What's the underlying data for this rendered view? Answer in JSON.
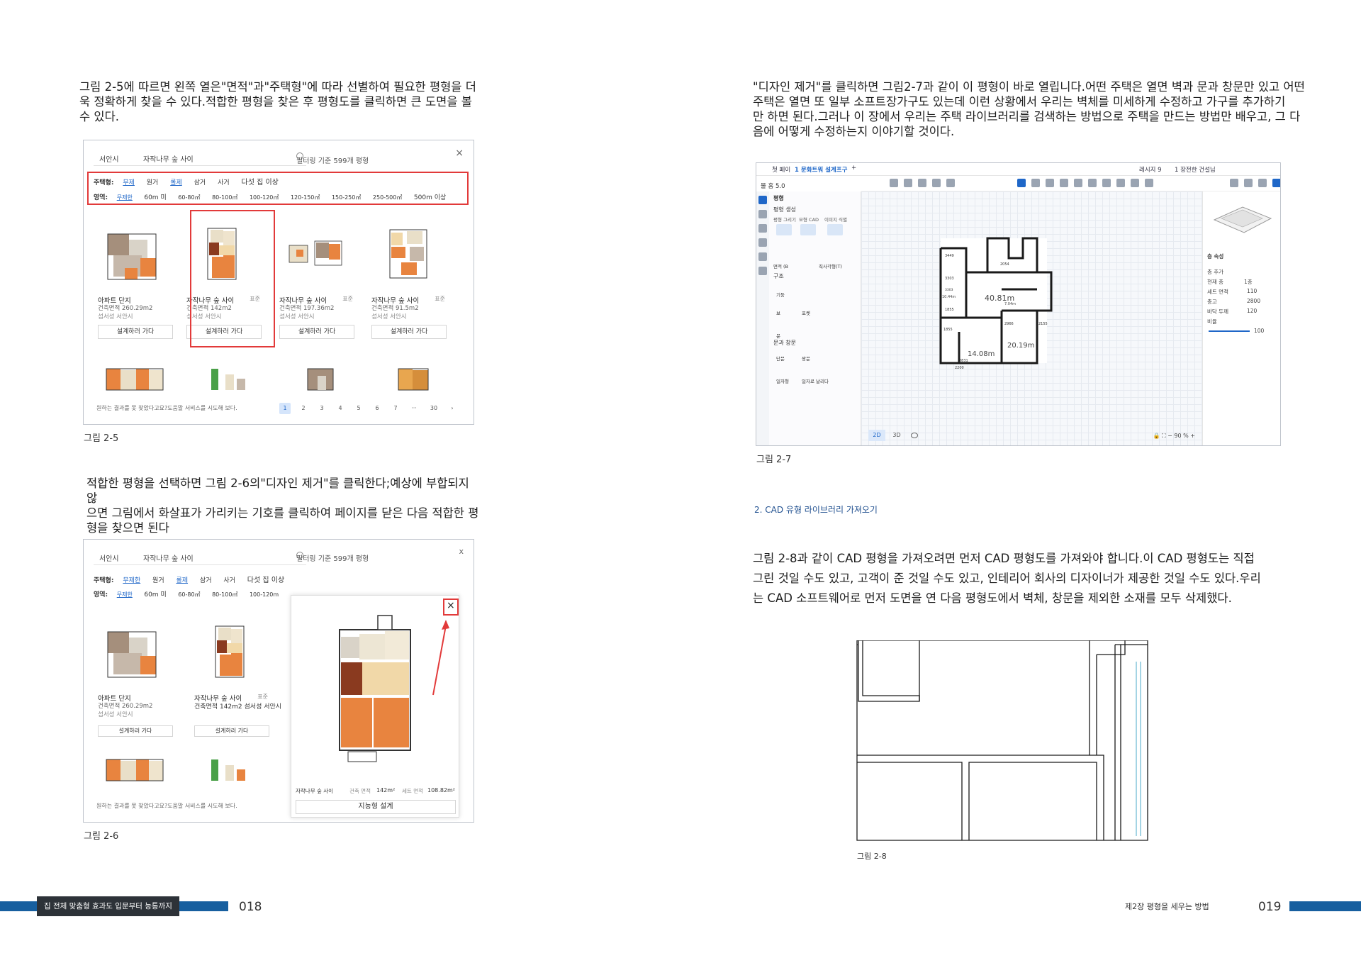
{
  "left": {
    "intro_lines": [
      "그림 2-5에 따르면 왼쪽 열은\"면적\"과\"주택형\"에 따라 선별하여 필요한 평형을 더",
      "욱 정확하게 찾을 수 있다.적합한 평형을 찾은 후 평형도를 클릭하면 큰 도면을 볼",
      "수 있다."
    ],
    "fig5": {
      "city": "서안시",
      "keyword": "자작나무 숲 사이",
      "count": "필터링 기준 599개 평형",
      "close": "×",
      "type_row": {
        "label": "주택형:",
        "items": [
          "무제",
          "원거",
          "롤제",
          "삼거",
          "사거",
          "다섯 집 이상"
        ]
      },
      "area_row": {
        "label": "영역:",
        "items": [
          "무제한",
          "60m 미",
          "60-80㎡",
          "80-100㎡",
          "100-120㎡",
          "120-150㎡",
          "150-250㎡",
          "250-500㎡",
          "500m 이상"
        ]
      },
      "cards": [
        {
          "t1": "아파트 단지",
          "t2": "건축면적 260.29m2",
          "t3": "섬서성 서안시",
          "tag": "",
          "btn": "설계하러 가다"
        },
        {
          "t1": "자작나무 숲 사이",
          "t2": "건축면적 142m2",
          "t3": "섬서성 서안시",
          "tag": "표준",
          "btn": "설계하러 가다"
        },
        {
          "t1": "자작나무 숲 사이",
          "t2": "건축면적 197.36m2",
          "t3": "섬서성 서안시",
          "tag": "표준",
          "btn": "설계하러 가다"
        },
        {
          "t1": "자작나무 숲 사이",
          "t2": "건축면적 91.5m2",
          "t3": "섬서성 서안시",
          "tag": "표준",
          "btn": "설계하러 가다"
        }
      ],
      "footer_note": "원하는 결과를 못 찾았다고요?도움말 서비스를 시도해 보다.",
      "pages": [
        "1",
        "2",
        "3",
        "4",
        "5",
        "6",
        "7",
        "···",
        "30",
        "›"
      ]
    },
    "fig5_caption": "그림 2-5",
    "mid_lines": [
      "적합한 평형을 선택하면 그림 2-6의\"디자인 제거\"를 클릭한다;예상에 부합되지 않",
      "으면 그림에서 화살표가 가리키는 기호를 클릭하여 페이지를 닫은 다음 적합한 평",
      "형을 찾으면 된다"
    ],
    "fig6": {
      "city": "서안시",
      "keyword": "자작나무 숲 사이",
      "count": "필터링 기준 599개 평형",
      "close": "x",
      "type_row": {
        "label": "주택형:",
        "items": [
          "무제한",
          "원거",
          "롤제",
          "삼거",
          "사거",
          "다섯 집 이상"
        ]
      },
      "area_row": {
        "label": "영역:",
        "items": [
          "무제한",
          "60m 미",
          "60-80㎡",
          "80-100㎡",
          "100-120m"
        ]
      },
      "cards": [
        {
          "t1": "아파트 단지",
          "t2": "건축면적 260.29m2",
          "t3": "섬서성 서안시",
          "tag": "",
          "btn": "설계하러 가다"
        },
        {
          "t1": "자작나무 숲 사이",
          "t2": "건축면적 142m2 섬서성 서안시",
          "t3": "",
          "tag": "표준",
          "btn": "설계하러 가다"
        }
      ],
      "popup": {
        "close": "×",
        "name": "자작나무 숲 사이",
        "built_label": "건축 면적",
        "built_value": "142m²",
        "set_label": "세트 면적",
        "set_value": "108.82m²",
        "btn": "지능형 설계"
      },
      "footer_note": "원하는 결과를 못 찾았다고요?도움말 서비스를 시도해 보다."
    },
    "fig6_caption": "그림 2-6",
    "footer": {
      "tab": "집 전체 맞춤형 효과도 입문부터 능통까지",
      "page": "018"
    }
  },
  "right": {
    "intro_lines": [
      "\"디자인 제거\"를 클릭하면 그림2-7과 같이 이 평형이 바로 열립니다.어떤 주택은 열면 벽과 문과 창문만 있고 어떤",
      "주택은 열면 또 일부 소프트장가구도 있는데 이런 상황에서 우리는 벽체를 미세하게 수정하고 가구를 추가하기",
      "만 하면 된다.그러나 이 장에서 우리는 주택 라이브러리를 검색하는 방법으로 주택을 만드는 방법만 배우고, 그 다",
      "음에 어떻게 수정하는지 이야기할 것이다."
    ],
    "fig7": {
      "top_tabs": [
        "첫 페이",
        "1 문화트워 설계프구",
        "+"
      ],
      "top_right": [
        "레시지 9",
        "1 장전한 건설님"
      ],
      "project": "물 흠 5.0",
      "panel_title": "평형",
      "panel_sections": [
        "평형 생성",
        "구조",
        "문과 창문"
      ],
      "panel_tools": [
        "평형 그리기",
        "모형 CAD",
        "이미지 식별",
        "면적 (B",
        "직사각형(T)",
        "기둥",
        "보",
        "포켓",
        "문",
        "단문",
        "쌍문",
        "일자형",
        "일자로 날리다"
      ],
      "area_labels": [
        "40.81m",
        "20.19m",
        "14.08m",
        "10.44m",
        "7.04m"
      ],
      "dim_labels": [
        "3449",
        "2054",
        "3303",
        "3303",
        "1855",
        "1855",
        "2831",
        "2200",
        "2966",
        "2155"
      ],
      "view_2d": "2D",
      "view_3d": "3D",
      "zoom": "90",
      "right_panel": {
        "title": "층 속성",
        "rows": [
          "층 추가",
          "현재 층",
          "세트 면적",
          "층고",
          "바닥 두께",
          "비율"
        ],
        "values": [
          "1층",
          "110",
          "2800",
          "120",
          "100"
        ]
      }
    },
    "fig7_caption": "그림 2-7",
    "section_title": "2. CAD 유형 라이브러리 가져오기",
    "body_lines": [
      "그림 2-8과 같이 CAD 평형을 가져오려면 먼저 CAD 평형도를 가져와야 합니다.이 CAD 평형도는 직접",
      "그린 것일 수도 있고, 고객이 준 것일 수도 있고, 인테리어 회사의 디자이너가 제공한 것일 수도 있다.우리",
      "는 CAD 소프트웨어로 먼저 도면을 연 다음 평형도에서 벽체, 창문을 제외한 소재를 모두 삭제했다."
    ],
    "fig8_caption": "그림 2-8",
    "footer": {
      "chapter": "제2장 평형을 세우는 방법",
      "page": "019"
    }
  },
  "colors": {
    "accent_blue": "#175f9f",
    "highlight_red": "#e23a3a",
    "link_blue": "#1f67c8"
  }
}
